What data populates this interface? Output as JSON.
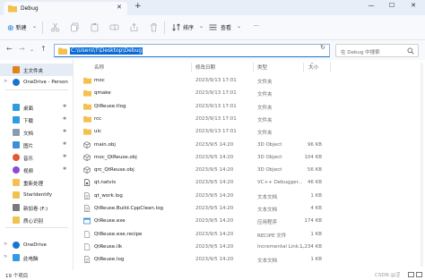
{
  "window": {
    "tab_title": "Debug",
    "tab_close": "✕",
    "new_tab": "+",
    "minimize": "—",
    "maximize": "☐",
    "close": "✕"
  },
  "toolbar": {
    "new_label": "新建",
    "sort_label": "排序",
    "view_label": "查看",
    "more_label": "···"
  },
  "address": {
    "path": "C:\\Users\\T\\Desktop\\Debug",
    "search_placeholder": "在 Debug 中搜索"
  },
  "sidebar": {
    "items": [
      {
        "label": "主文件夹",
        "icon": "home-icon",
        "color": "#e0841a",
        "selected": true,
        "pinned": false,
        "chevron": ""
      },
      {
        "label": "OneDrive - Person",
        "icon": "cloud-icon",
        "color": "#1a73d0",
        "selected": false,
        "pinned": false,
        "chevron": ">"
      },
      {
        "label": "桌面",
        "icon": "desktop-icon",
        "color": "#2f9be0",
        "selected": false,
        "pinned": true,
        "chevron": ""
      },
      {
        "label": "下载",
        "icon": "download-icon",
        "color": "#2f9be0",
        "selected": false,
        "pinned": true,
        "chevron": ""
      },
      {
        "label": "文档",
        "icon": "documents-icon",
        "color": "#8a9bb0",
        "selected": false,
        "pinned": true,
        "chevron": ""
      },
      {
        "label": "图片",
        "icon": "pictures-icon",
        "color": "#3a8fd8",
        "selected": false,
        "pinned": true,
        "chevron": ""
      },
      {
        "label": "音乐",
        "icon": "music-icon",
        "color": "#e05a3a",
        "selected": false,
        "pinned": true,
        "chevron": ""
      },
      {
        "label": "视频",
        "icon": "videos-icon",
        "color": "#8a4ad8",
        "selected": false,
        "pinned": true,
        "chevron": ""
      },
      {
        "label": "重新处理",
        "icon": "folder-icon",
        "color": "#f2c14e",
        "selected": false,
        "pinned": false,
        "chevron": ""
      },
      {
        "label": "StarIdentify",
        "icon": "folder-icon",
        "color": "#f2c14e",
        "selected": false,
        "pinned": false,
        "chevron": ""
      },
      {
        "label": "新加卷 (F:)",
        "icon": "drive-icon",
        "color": "#7a7a7a",
        "selected": false,
        "pinned": false,
        "chevron": ""
      },
      {
        "label": "质心识别",
        "icon": "folder-icon",
        "color": "#f2c14e",
        "selected": false,
        "pinned": false,
        "chevron": ""
      },
      {
        "label": "OneDrive",
        "icon": "cloud-icon",
        "color": "#1a73d0",
        "selected": false,
        "pinned": false,
        "chevron": ">"
      },
      {
        "label": "此电脑",
        "icon": "computer-icon",
        "color": "#2f9be0",
        "selected": false,
        "pinned": false,
        "chevron": ">"
      }
    ],
    "pin_glyph": "✱"
  },
  "columns": {
    "name": "名称",
    "date": "修改日期",
    "type": "类型",
    "size": "大小"
  },
  "files": [
    {
      "name": "moc",
      "date": "2023/9/13 17:01",
      "type": "文件夹",
      "size": "",
      "icon": "folder-icon",
      "color": "#f2c14e"
    },
    {
      "name": "qmake",
      "date": "2023/9/13 17:01",
      "type": "文件夹",
      "size": "",
      "icon": "folder-icon",
      "color": "#f2c14e"
    },
    {
      "name": "QtReuse.tlog",
      "date": "2023/9/13 17:01",
      "type": "文件夹",
      "size": "",
      "icon": "folder-icon",
      "color": "#f2c14e"
    },
    {
      "name": "rcc",
      "date": "2023/9/13 17:01",
      "type": "文件夹",
      "size": "",
      "icon": "folder-icon",
      "color": "#f2c14e"
    },
    {
      "name": "uic",
      "date": "2023/9/13 17:01",
      "type": "文件夹",
      "size": "",
      "icon": "folder-icon",
      "color": "#f2c14e"
    },
    {
      "name": "main.obj",
      "date": "2023/9/5 14:20",
      "type": "3D Object",
      "size": "96 KB",
      "icon": "object-file-icon",
      "color": "#6a6a6a"
    },
    {
      "name": "moc_QtReuse.obj",
      "date": "2023/9/5 14:20",
      "type": "3D Object",
      "size": "104 KB",
      "icon": "object-file-icon",
      "color": "#6a6a6a"
    },
    {
      "name": "qrc_QtReuse.obj",
      "date": "2023/9/5 14:20",
      "type": "3D Object",
      "size": "56 KB",
      "icon": "object-file-icon",
      "color": "#6a6a6a"
    },
    {
      "name": "qt.natvis",
      "date": "2023/9/5 14:20",
      "type": "VC++ Debugger...",
      "size": "46 KB",
      "icon": "natvis-file-icon",
      "color": "#555555"
    },
    {
      "name": "qt_work.log",
      "date": "2023/9/5 14:20",
      "type": "文本文档",
      "size": "1 KB",
      "icon": "text-file-icon",
      "color": "#8a8a8a"
    },
    {
      "name": "QtReuse.Build.CppClean.log",
      "date": "2023/9/5 14:20",
      "type": "文本文档",
      "size": "4 KB",
      "icon": "text-file-icon",
      "color": "#8a8a8a"
    },
    {
      "name": "QtReuse.exe",
      "date": "2023/9/5 14:20",
      "type": "应用程序",
      "size": "174 KB",
      "icon": "exe-file-icon",
      "color": "#3a8fd8"
    },
    {
      "name": "QtReuse.exe.recipe",
      "date": "2023/9/5 14:20",
      "type": "RECIPE 文件",
      "size": "1 KB",
      "icon": "blank-file-icon",
      "color": "#9a9a9a"
    },
    {
      "name": "QtReuse.ilk",
      "date": "2023/9/5 14:20",
      "type": "Incremental Link...",
      "size": "1,234 KB",
      "icon": "blank-file-icon",
      "color": "#9a9a9a"
    },
    {
      "name": "QtReuse.log",
      "date": "2023/9/5 14:20",
      "type": "文本文档",
      "size": "1 KB",
      "icon": "text-file-icon",
      "color": "#8a8a8a"
    }
  ],
  "status": {
    "count": "19 个项目",
    "watermark": "CSDN @涩"
  },
  "colors": {
    "accent": "#1a73d0",
    "selection": "#0a6cd6",
    "folder": "#f2c14e"
  }
}
